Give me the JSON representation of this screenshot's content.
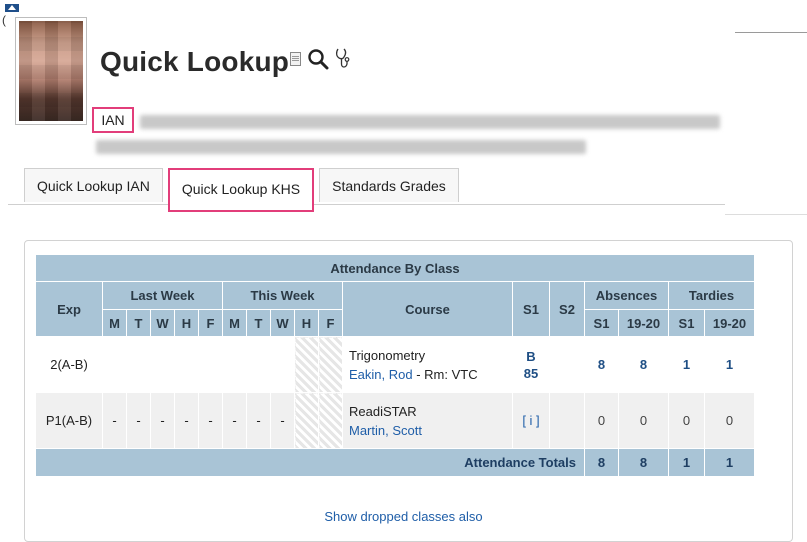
{
  "header": {
    "title": "Quick Lookup",
    "student_name": "IAN",
    "icons": [
      "document-icon",
      "search-icon",
      "stethoscope-icon"
    ]
  },
  "tabs": [
    {
      "label": "Quick Lookup IAN",
      "active": false
    },
    {
      "label": "Quick Lookup KHS",
      "active": true
    },
    {
      "label": "Standards Grades",
      "active": false
    }
  ],
  "table": {
    "title": "Attendance By Class",
    "headers": {
      "exp": "Exp",
      "last_week": "Last Week",
      "this_week": "This Week",
      "course": "Course",
      "s1": "S1",
      "s2": "S2",
      "absences": "Absences",
      "tardies": "Tardies",
      "days": [
        "M",
        "T",
        "W",
        "H",
        "F"
      ],
      "abs_s1": "S1",
      "abs_year": "19-20",
      "tar_s1": "S1",
      "tar_year": "19-20"
    },
    "rows": [
      {
        "exp": "2(A-B)",
        "course": "Trigonometry",
        "teacher": "Eakin, Rod",
        "room": " - Rm: VTC",
        "grade_letter": "B",
        "grade_pct": "85",
        "abs_s1": "8",
        "abs_year": "8",
        "tar_s1": "1",
        "tar_year": "1"
      },
      {
        "exp": "P1(A-B)",
        "marks": [
          "-",
          "-",
          "-",
          "-",
          "-",
          "-",
          "-",
          "-"
        ],
        "course": "ReadiSTAR",
        "teacher": "Martin, Scott",
        "grade_info": "[ i ]",
        "abs_s1": "0",
        "abs_year": "0",
        "tar_s1": "0",
        "tar_year": "0"
      }
    ],
    "totals": {
      "label": "Attendance Totals",
      "abs_s1": "8",
      "abs_year": "8",
      "tar_s1": "1",
      "tar_year": "1"
    }
  },
  "footer": {
    "dropped_link": "Show dropped classes also"
  }
}
